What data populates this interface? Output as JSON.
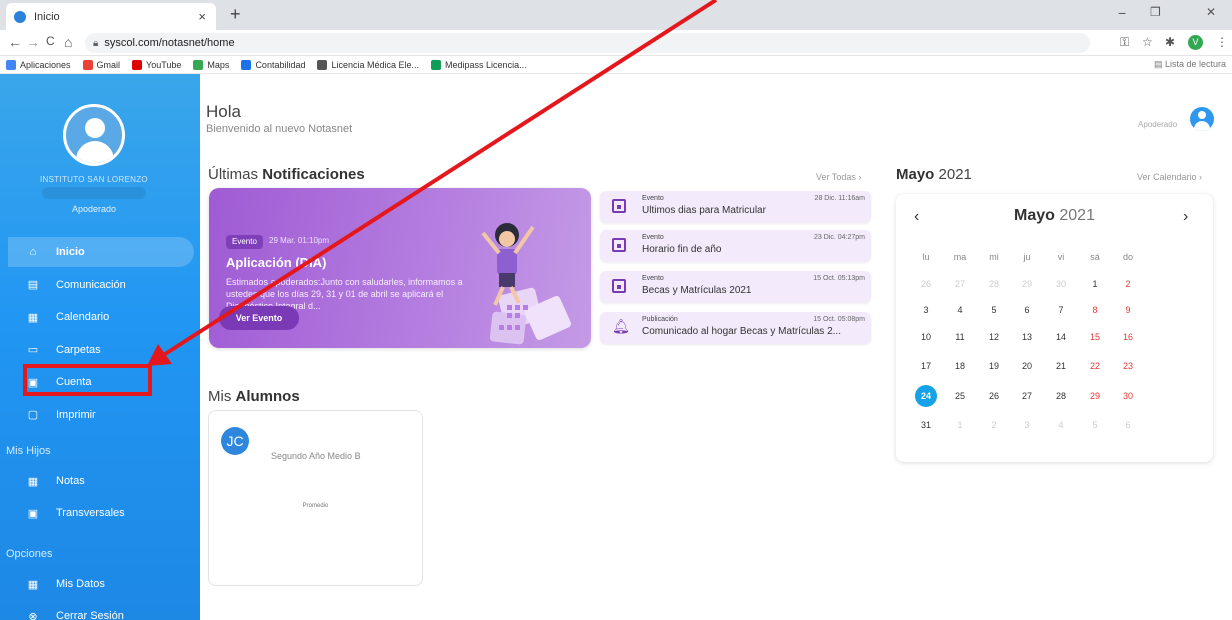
{
  "browser": {
    "tab_title": "Inicio",
    "tab_close": "×",
    "new_tab": "+",
    "url": "syscol.com/notasnet/home",
    "nav_back": "←",
    "nav_forward": "→",
    "nav_reload": "C",
    "nav_home": "⌂",
    "win_minimize": "−",
    "win_maximize": "❐",
    "win_close": "✕",
    "profile_initial": "V",
    "bookmarks": [
      {
        "label": "Aplicaciones",
        "color": "#4285f4"
      },
      {
        "label": "Gmail",
        "color": "#ea4335"
      },
      {
        "label": "YouTube",
        "color": "#e00000"
      },
      {
        "label": "Maps",
        "color": "#34a853"
      },
      {
        "label": "Contabilidad",
        "color": "#1a73e8"
      },
      {
        "label": "Licencia Médica Ele...",
        "color": "#555555"
      },
      {
        "label": "Medipass Licencia...",
        "color": "#0f9d58"
      }
    ],
    "reading_list": "Lista de lectura"
  },
  "sidebar": {
    "school_name": "INSTITUTO SAN LORENZO",
    "role": "Apoderado",
    "items": [
      {
        "label": "Inicio",
        "icon": "home-icon",
        "glyph": "⌂"
      },
      {
        "label": "Comunicación",
        "icon": "message-icon",
        "glyph": "▤"
      },
      {
        "label": "Calendario",
        "icon": "calendar-icon",
        "glyph": "▦"
      },
      {
        "label": "Carpetas",
        "icon": "folder-icon",
        "glyph": "▭"
      },
      {
        "label": "Cuenta",
        "icon": "account-icon",
        "glyph": "▣"
      },
      {
        "label": "Imprimir",
        "icon": "print-icon",
        "glyph": "▢"
      }
    ],
    "section_hijos": "Mis Hijos",
    "hijos_items": [
      {
        "label": "Notas",
        "icon": "grid-icon",
        "glyph": "▦"
      },
      {
        "label": "Transversales",
        "icon": "badge-icon",
        "glyph": "▣"
      }
    ],
    "section_opciones": "Opciones",
    "opciones_items": [
      {
        "label": "Mis Datos",
        "icon": "calendar-icon",
        "glyph": "▦"
      },
      {
        "label": "Cerrar Sesión",
        "icon": "close-circle-icon",
        "glyph": "⊗"
      }
    ]
  },
  "header": {
    "greeting": "Hola",
    "welcome": "Bienvenido al nuevo Notasnet",
    "role": "Apoderado"
  },
  "notifications": {
    "title_light": "Últimas",
    "title_bold": "Notificaciones",
    "see_all": "Ver Todas ›",
    "featured": {
      "badge": "Evento",
      "date": "29 Mar. 01:10pm",
      "title": "Aplicación (DIA)",
      "description": "Estimados apoderados:Junto con saludarles, informamos a ustedes que los días 29, 31 y 01 de abril se aplicará el Diagnóstico Integral d...",
      "button": "Ver Evento"
    },
    "items": [
      {
        "type": "Evento",
        "date": "28 Dic. 11:16am",
        "title": "Últimos dias para Matricular",
        "icon": "calendar-icon"
      },
      {
        "type": "Evento",
        "date": "23 Dic. 04:27pm",
        "title": "Horario fin de año",
        "icon": "calendar-icon"
      },
      {
        "type": "Evento",
        "date": "15 Oct. 05:13pm",
        "title": "Becas y Matrículas 2021",
        "icon": "calendar-icon"
      },
      {
        "type": "Publicación",
        "date": "15 Oct. 05:08pm",
        "title": "Comunicado al hogar Becas y Matrículas 2...",
        "icon": "bell-icon"
      }
    ]
  },
  "students": {
    "title_light": "Mis",
    "title_bold": "Alumnos",
    "list": [
      {
        "initials": "JC",
        "grade": "Segundo Año Medio B",
        "average_label": "Promedio"
      }
    ]
  },
  "calendar": {
    "section_month": "Mayo",
    "section_year": "2021",
    "see_calendar": "Ver Calendario ›",
    "month": "Mayo",
    "year": "2021",
    "prev": "‹",
    "next": "›",
    "weekdays": [
      "lu",
      "ma",
      "mi",
      "ju",
      "vi",
      "sá",
      "do"
    ],
    "weeks": [
      [
        "26",
        "27",
        "28",
        "29",
        "30",
        "1",
        "2"
      ],
      [
        "3",
        "4",
        "5",
        "6",
        "7",
        "8",
        "9"
      ],
      [
        "10",
        "11",
        "12",
        "13",
        "14",
        "15",
        "16"
      ],
      [
        "17",
        "18",
        "19",
        "20",
        "21",
        "22",
        "23"
      ],
      [
        "24",
        "25",
        "26",
        "27",
        "28",
        "29",
        "30"
      ],
      [
        "31",
        "1",
        "2",
        "3",
        "4",
        "5",
        "6"
      ]
    ],
    "today": "24",
    "accent_color": "#17a2e8",
    "weekend_color": "#e53935"
  },
  "annotation": {
    "highlight_color": "#e3171c",
    "highlight_target": "Cuenta"
  }
}
